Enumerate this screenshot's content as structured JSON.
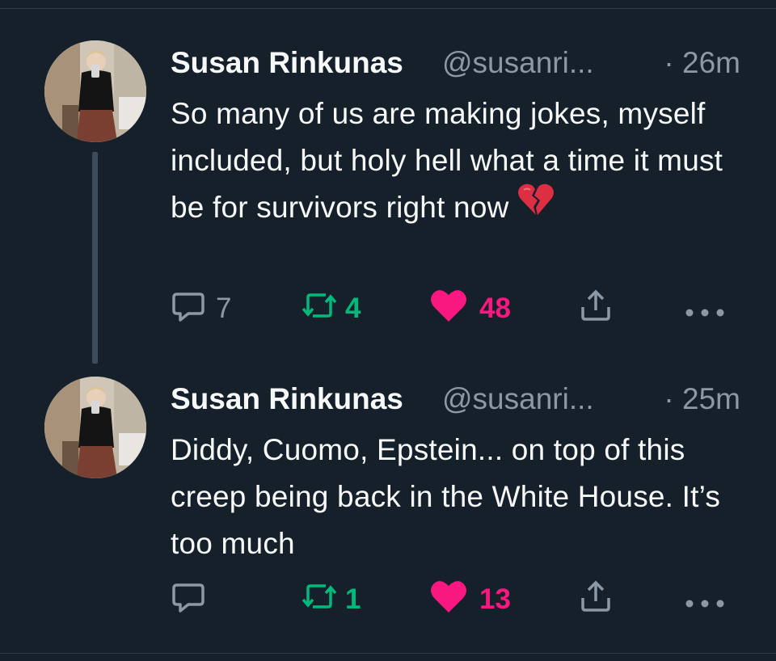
{
  "colors": {
    "background": "#15202b",
    "text": "#f7f9f9",
    "muted": "#8b98a5",
    "retweet": "#00ba7c",
    "like": "#f91880",
    "thread_line": "#3c4c5c"
  },
  "tweets": [
    {
      "author_name": "Susan Rinkunas",
      "handle": "@susanri...",
      "time": "· 26m",
      "text": "So many of us are making jokes, myself included, but holy hell what a time it must be for survivors right now",
      "emoji": "broken-heart-emoji",
      "replies": "7",
      "retweets": "4",
      "likes": "48",
      "liked": true,
      "retweeted": true
    },
    {
      "author_name": "Susan Rinkunas",
      "handle": "@susanri...",
      "time": "· 25m",
      "text": "Diddy, Cuomo, Epstein... on top of this creep being back in the White House. It’s too much",
      "replies": "",
      "retweets": "1",
      "likes": "13",
      "liked": true,
      "retweeted": true
    }
  ],
  "icons": {
    "reply": "reply-icon",
    "retweet": "retweet-icon",
    "like": "heart-icon",
    "share": "share-icon",
    "more": "more-icon"
  }
}
